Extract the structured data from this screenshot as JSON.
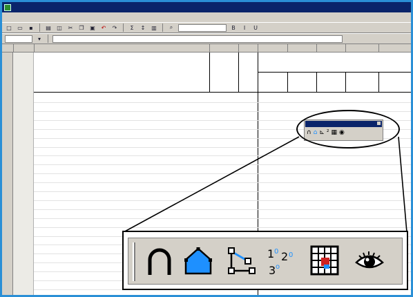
{
  "window": {
    "title": ""
  },
  "menu": {
    "items": [
      "",
      "",
      "",
      "",
      "",
      "",
      "",
      "",
      ""
    ]
  },
  "toolbar1": {
    "font_combo": ""
  },
  "toolbar2": {
    "cell_ref": ""
  },
  "sheet": {
    "header_group": "",
    "col_item": "",
    "col_qty": "",
    "col_unit": "",
    "col_a": "",
    "col_b": "",
    "col_c": "",
    "col_d": "",
    "col_e": "",
    "rows": [
      {
        "num": "",
        "text": "",
        "style": "red"
      },
      {
        "num": "",
        "text": "",
        "style": "blue"
      },
      {
        "num": "",
        "text": "",
        "style": "bold"
      },
      {
        "num": "",
        "text": "",
        "style": ""
      },
      {
        "num": "",
        "text": "",
        "style": ""
      },
      {
        "num": "",
        "text": "",
        "style": "bold"
      },
      {
        "num": "",
        "text": "",
        "style": ""
      },
      {
        "num": "",
        "text": "",
        "style": ""
      },
      {
        "num": "",
        "text": "",
        "style": ""
      },
      {
        "num": "",
        "text": "",
        "style": ""
      },
      {
        "num": "",
        "text": "",
        "style": ""
      },
      {
        "num": "",
        "text": "",
        "style": ""
      },
      {
        "num": "",
        "text": "",
        "style": ""
      },
      {
        "num": "",
        "text": "",
        "style": ""
      },
      {
        "num": "",
        "text": "",
        "style": "blue"
      },
      {
        "num": "",
        "text": "",
        "style": ""
      },
      {
        "num": "",
        "text": "",
        "style": ""
      },
      {
        "num": "",
        "text": "",
        "style": ""
      },
      {
        "num": "",
        "text": "",
        "style": ""
      },
      {
        "num": "",
        "text": "",
        "style": ""
      },
      {
        "num": "",
        "text": "",
        "style": ""
      },
      {
        "num": "",
        "text": "",
        "style": ""
      }
    ]
  },
  "floating_toolbar": {
    "title": ""
  },
  "zoom_icons": [
    "arch-icon",
    "house-polygon-icon",
    "edit-vertices-icon",
    "numbering-icon",
    "color-grid-icon",
    "eye-icon"
  ],
  "colors": {
    "titlebar": "#0a246a",
    "frame": "#2a8fd6",
    "accent_red": "#cc0000",
    "accent_blue": "#1a1aa8",
    "polygon_fill": "#1e90ff"
  }
}
